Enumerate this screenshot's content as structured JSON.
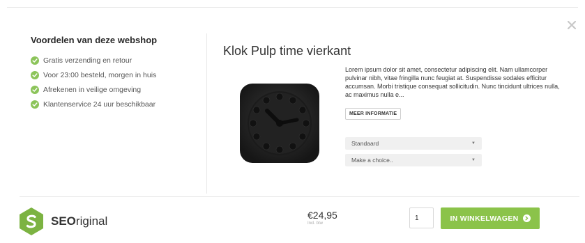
{
  "benefits": {
    "title": "Voordelen van deze webshop",
    "items": [
      {
        "label": "Gratis verzending en retour"
      },
      {
        "label": "Voor 23:00 besteld, morgen in huis"
      },
      {
        "label": "Afrekenen in veilige omgeving"
      },
      {
        "label": "Klantenservice 24 uur beschikbaar"
      }
    ]
  },
  "product": {
    "title": "Klok Pulp time vierkant",
    "description": "Lorem ipsum dolor sit amet, consectetur adipiscing elit. Nam ullamcorper pulvinar nibh, vitae fringilla nunc feugiat at. Suspendisse sodales efficitur accumsan. Morbi tristique consequat sollicitudin. Nunc tincidunt ultrices nulla, ac maximus nulla e...",
    "more_info_label": "MEER INFORMATIE",
    "options": [
      {
        "value": "Standaard"
      },
      {
        "value": "Make a choice.."
      }
    ]
  },
  "footer": {
    "logo_bold": "SEO",
    "logo_rest": "riginal",
    "price": "€24,95",
    "price_note": "Incl. btw",
    "quantity": "1",
    "cart_label": "IN WINKELWAGEN"
  },
  "colors": {
    "accent": "#8bc34a",
    "check": "#8cc45a",
    "logo_green": "#7cb342"
  },
  "icons": {
    "close": "close-icon",
    "check": "check-icon",
    "chevron": "chevron-down-icon",
    "arrow": "arrow-right-circle-icon"
  }
}
